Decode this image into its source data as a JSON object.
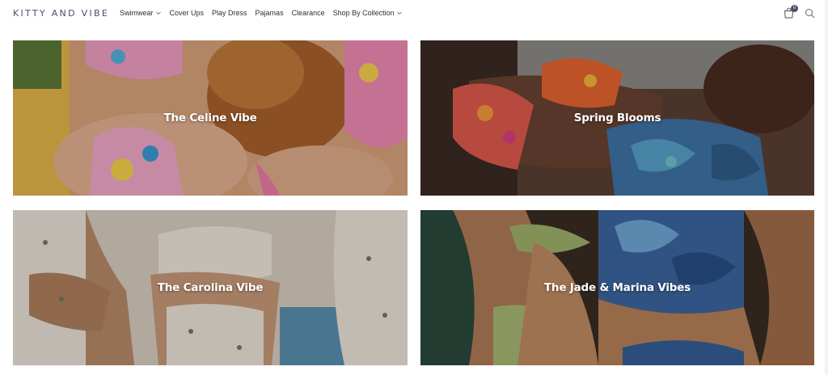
{
  "brand": {
    "logo_text": "KITTY AND VIBE"
  },
  "nav": {
    "items": [
      {
        "label": "Swimwear",
        "has_dropdown": true
      },
      {
        "label": "Cover Ups",
        "has_dropdown": false
      },
      {
        "label": "Play Dress",
        "has_dropdown": false
      },
      {
        "label": "Pajamas",
        "has_dropdown": false
      },
      {
        "label": "Clearance",
        "has_dropdown": false
      },
      {
        "label": "Shop By Collection",
        "has_dropdown": true
      }
    ]
  },
  "header_icons": {
    "cart": {
      "icon": "shopping-bag-icon",
      "count": "0"
    },
    "search": {
      "icon": "search-icon"
    }
  },
  "collections": [
    {
      "title": "The Celine Vibe"
    },
    {
      "title": "Spring Blooms"
    },
    {
      "title": "The Carolina Vibe"
    },
    {
      "title": "The Jade & Marina Vibes"
    }
  ],
  "colors": {
    "logo": "#4a4f6a",
    "nav_text": "#2f2f2f",
    "tile_text": "#ffffff"
  }
}
